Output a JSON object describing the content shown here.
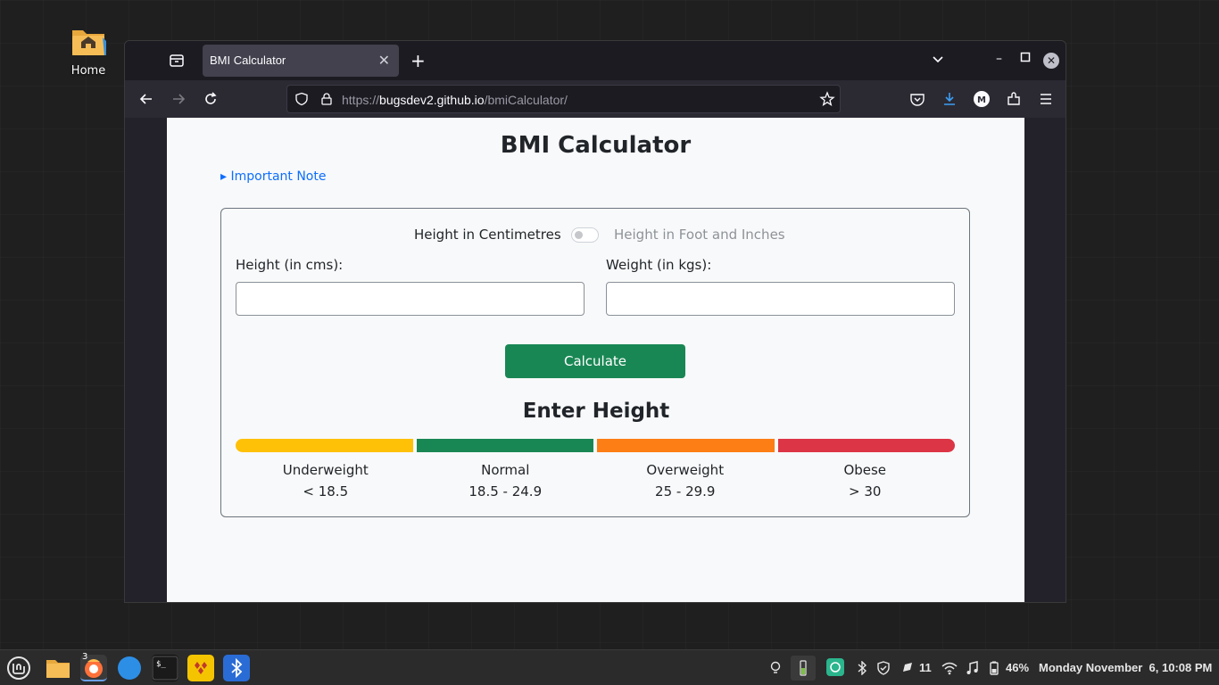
{
  "desktop": {
    "home_label": "Home"
  },
  "browser": {
    "tab_title": "BMI Calculator",
    "url_proto": "https://",
    "url_host": "bugsdev2.github.io",
    "url_path": "/bmiCalculator/"
  },
  "page": {
    "title": "BMI Calculator",
    "note_link": "▸ Important Note",
    "unit_switch": {
      "left_label": "Height in Centimetres",
      "right_label": "Height in Foot and Inches",
      "checked": false
    },
    "height_label": "Height (in cms):",
    "weight_label": "Weight (in kgs):",
    "height_value": "",
    "weight_value": "",
    "calculate_label": "Calculate",
    "result_text": "Enter Height",
    "categories": [
      {
        "name": "Underweight",
        "range": "< 18.5",
        "color": "#ffc107"
      },
      {
        "name": "Normal",
        "range": "18.5 - 24.9",
        "color": "#198754"
      },
      {
        "name": "Overweight",
        "range": "25 - 29.9",
        "color": "#fd7e14"
      },
      {
        "name": "Obese",
        "range": "> 30",
        "color": "#dc3545"
      }
    ]
  },
  "taskbar": {
    "firefox_badge": "3",
    "notification_count": "11",
    "battery": "46%",
    "datetime": "Monday November  6, 10:08 PM"
  }
}
